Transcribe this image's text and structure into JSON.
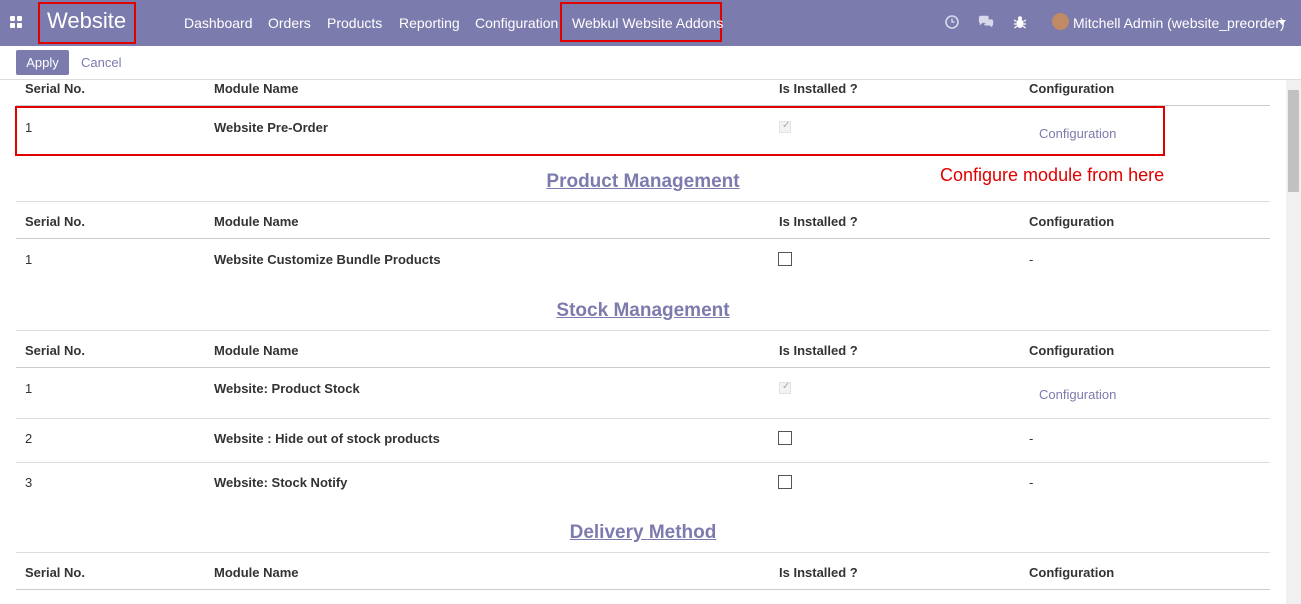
{
  "navbar": {
    "brand": "Website",
    "menu": [
      "Dashboard",
      "Orders",
      "Products",
      "Reporting",
      "Configuration",
      "Webkul Website Addons"
    ],
    "user": "Mitchell Admin (website_preorder)",
    "color": "#7c7bad"
  },
  "control": {
    "apply": "Apply",
    "cancel": "Cancel"
  },
  "headers": {
    "serial": "Serial No.",
    "module": "Module Name",
    "installed": "Is Installed ?",
    "config": "Configuration"
  },
  "annotation": "Configure module from here",
  "top_rows": [
    {
      "serial": "1",
      "module": "Website Pre-Order",
      "installed": true,
      "config": "Configuration"
    }
  ],
  "sections": [
    {
      "title": "Product Management",
      "rows": [
        {
          "serial": "1",
          "module": "Website Customize Bundle Products",
          "installed": false,
          "config": "-"
        }
      ]
    },
    {
      "title": "Stock Management",
      "rows": [
        {
          "serial": "1",
          "module": "Website: Product Stock",
          "installed": true,
          "config": "Configuration"
        },
        {
          "serial": "2",
          "module": "Website : Hide out of stock products",
          "installed": false,
          "config": "-"
        },
        {
          "serial": "3",
          "module": "Website: Stock Notify",
          "installed": false,
          "config": "-"
        }
      ]
    },
    {
      "title": "Delivery Method",
      "rows": []
    }
  ],
  "colors": {
    "accent": "#7c7bad",
    "annotation": "#e00000"
  }
}
